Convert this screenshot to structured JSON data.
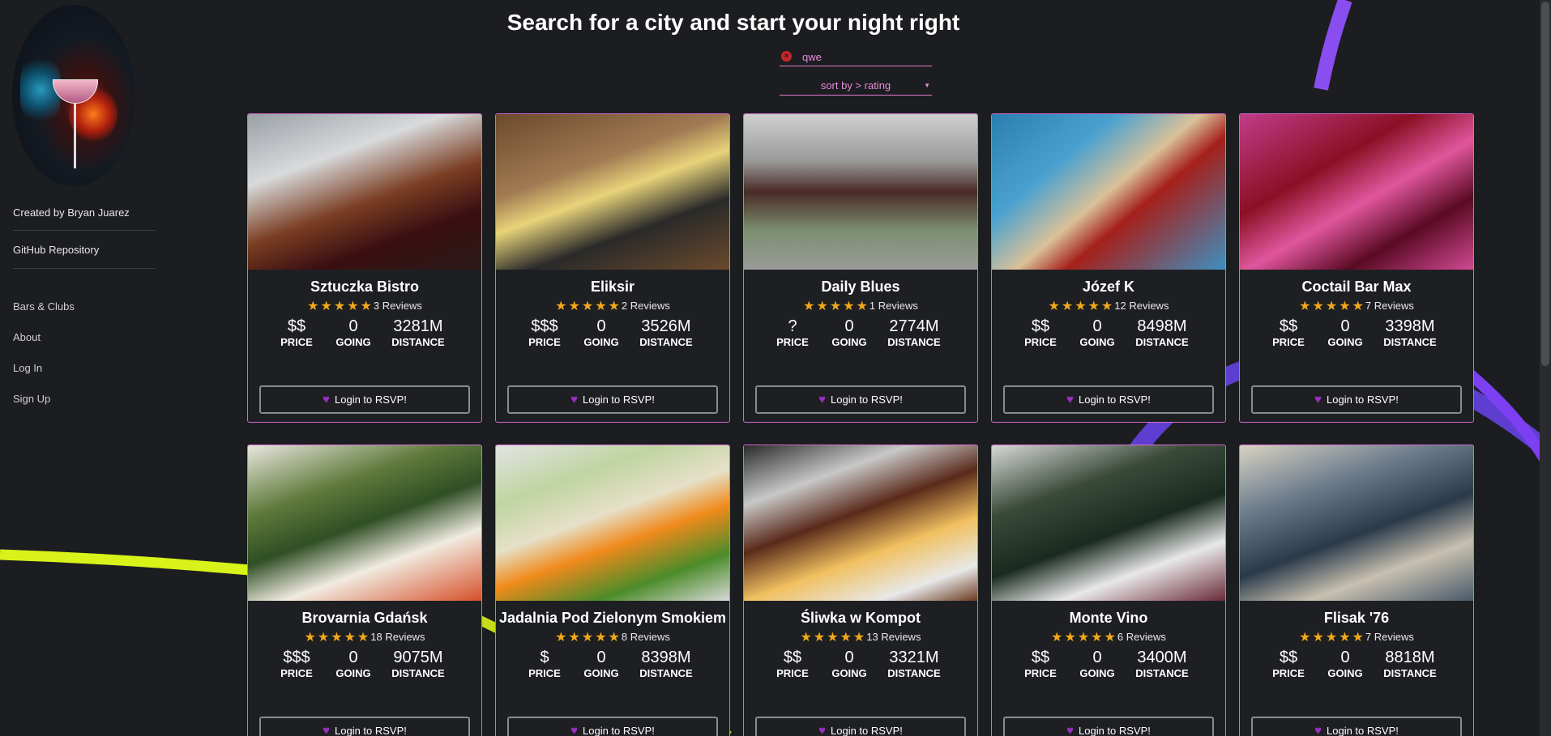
{
  "sidebar": {
    "credit": "Created by Bryan Juarez",
    "repo": "GitHub Repository",
    "nav": [
      "Bars & Clubs",
      "About",
      "Log In",
      "Sign Up"
    ]
  },
  "header": {
    "title": "Search for a city and start your night right",
    "search_value": "qwe",
    "sort_label": "sort by > rating"
  },
  "labels": {
    "price": "PRICE",
    "going": "GOING",
    "distance": "DISTANCE",
    "rsvp": "Login to RSVP!"
  },
  "stars": "★★★★★",
  "colors": {
    "accent": "#d26ad0",
    "star": "#f0a91a",
    "heart": "#9a2fc0",
    "background": "#1c1d20"
  },
  "cards": [
    {
      "name": "Sztuczka Bistro",
      "reviews": "3 Reviews",
      "price": "$$",
      "going": "0",
      "distance": "3281M"
    },
    {
      "name": "Eliksir",
      "reviews": "2 Reviews",
      "price": "$$$",
      "going": "0",
      "distance": "3526M"
    },
    {
      "name": "Daily Blues",
      "reviews": "1 Reviews",
      "price": "?",
      "going": "0",
      "distance": "2774M"
    },
    {
      "name": "Józef K",
      "reviews": "12 Reviews",
      "price": "$$",
      "going": "0",
      "distance": "8498M"
    },
    {
      "name": "Coctail Bar Max",
      "reviews": "7 Reviews",
      "price": "$$",
      "going": "0",
      "distance": "3398M"
    },
    {
      "name": "Brovarnia Gdańsk",
      "reviews": "18 Reviews",
      "price": "$$$",
      "going": "0",
      "distance": "9075M"
    },
    {
      "name": "Jadalnia Pod Zielonym Smokiem",
      "reviews": "8 Reviews",
      "price": "$",
      "going": "0",
      "distance": "8398M"
    },
    {
      "name": "Śliwka w Kompot",
      "reviews": "13 Reviews",
      "price": "$$",
      "going": "0",
      "distance": "3321M"
    },
    {
      "name": "Monte Vino",
      "reviews": "6 Reviews",
      "price": "$$",
      "going": "0",
      "distance": "3400M"
    },
    {
      "name": "Flisak '76",
      "reviews": "7 Reviews",
      "price": "$$",
      "going": "0",
      "distance": "8818M"
    }
  ]
}
